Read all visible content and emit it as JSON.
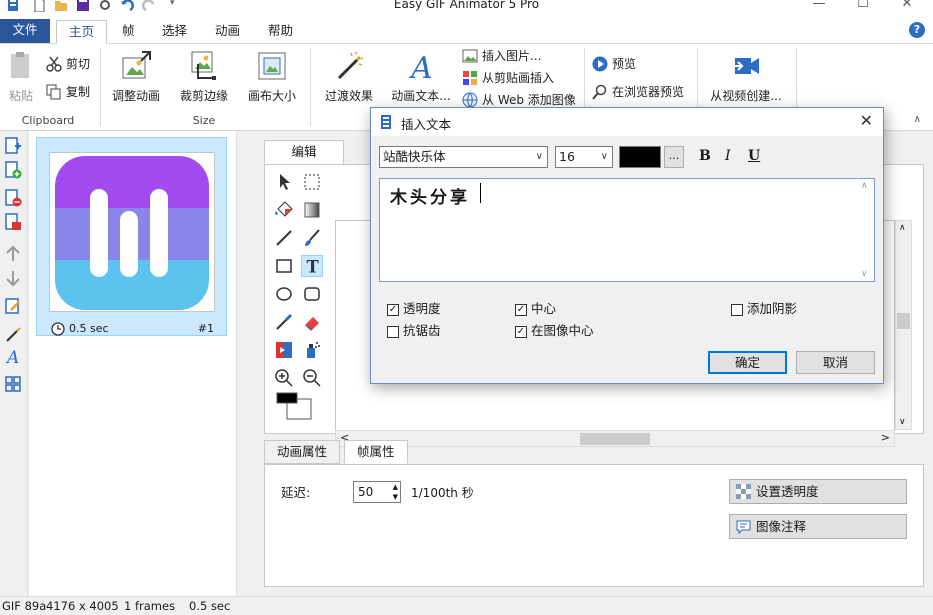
{
  "window": {
    "title": "Easy GIF Animator 5 Pro",
    "minimize": "—",
    "maximize": "☐",
    "close": "✕"
  },
  "menu": {
    "file": "文件",
    "tabs": [
      "主页",
      "帧",
      "选择",
      "动画",
      "帮助"
    ],
    "help": "?"
  },
  "ribbon": {
    "paste": "粘贴",
    "cut": "剪切",
    "copy": "复制",
    "adjust_anim": "调整动画",
    "crop_edges": "裁剪边缘",
    "canvas_size": "画布大小",
    "transition": "过渡效果",
    "anim_text": "动画文本...",
    "insert_image": "插入图片...",
    "insert_clipboard": "从剪贴画插入",
    "insert_web": "从 Web 添加图像",
    "preview": "预览",
    "browser_preview": "在浏览器预览",
    "from_video": "从视频创建...",
    "group_clipboard": "Clipboard",
    "group_size": "Size",
    "collapse": "∧"
  },
  "frames": [
    {
      "delay": "0.5 sec",
      "number": "#1"
    }
  ],
  "editor": {
    "tab_edit": "编辑",
    "tab_anim_props": "动画属性",
    "tab_frame_props": "帧属性",
    "delay_label": "延迟:",
    "delay_value": "50",
    "delay_unit": "1/100th 秒",
    "set_transparency": "设置透明度",
    "image_comment": "图像注释",
    "hscroll_left": "<",
    "hscroll_right": ">"
  },
  "status": {
    "format": "GIF 89a",
    "dimensions": "4176 x 4005",
    "frames": "1 frames",
    "duration": "0.5 sec"
  },
  "dialog": {
    "title": "插入文本",
    "close": "✕",
    "font": "站酷快乐体",
    "size": "16",
    "color": "#000000",
    "more": "...",
    "bold": "B",
    "italic": "I",
    "underline": "U",
    "text": "木头分享",
    "options": [
      {
        "label": "透明度",
        "checked": true
      },
      {
        "label": "中心",
        "checked": true
      },
      {
        "label": "添加阴影",
        "checked": false
      },
      {
        "label": "抗锯齿",
        "checked": false
      },
      {
        "label": "在图像中心",
        "checked": true
      }
    ],
    "ok": "确定",
    "cancel": "取消"
  },
  "colors": {
    "accent": "#2b579a",
    "selection": "#cce8ff",
    "icon_purple": "#a24cf0",
    "icon_mid": "#8a85e8",
    "icon_blue": "#5cc3ef"
  }
}
